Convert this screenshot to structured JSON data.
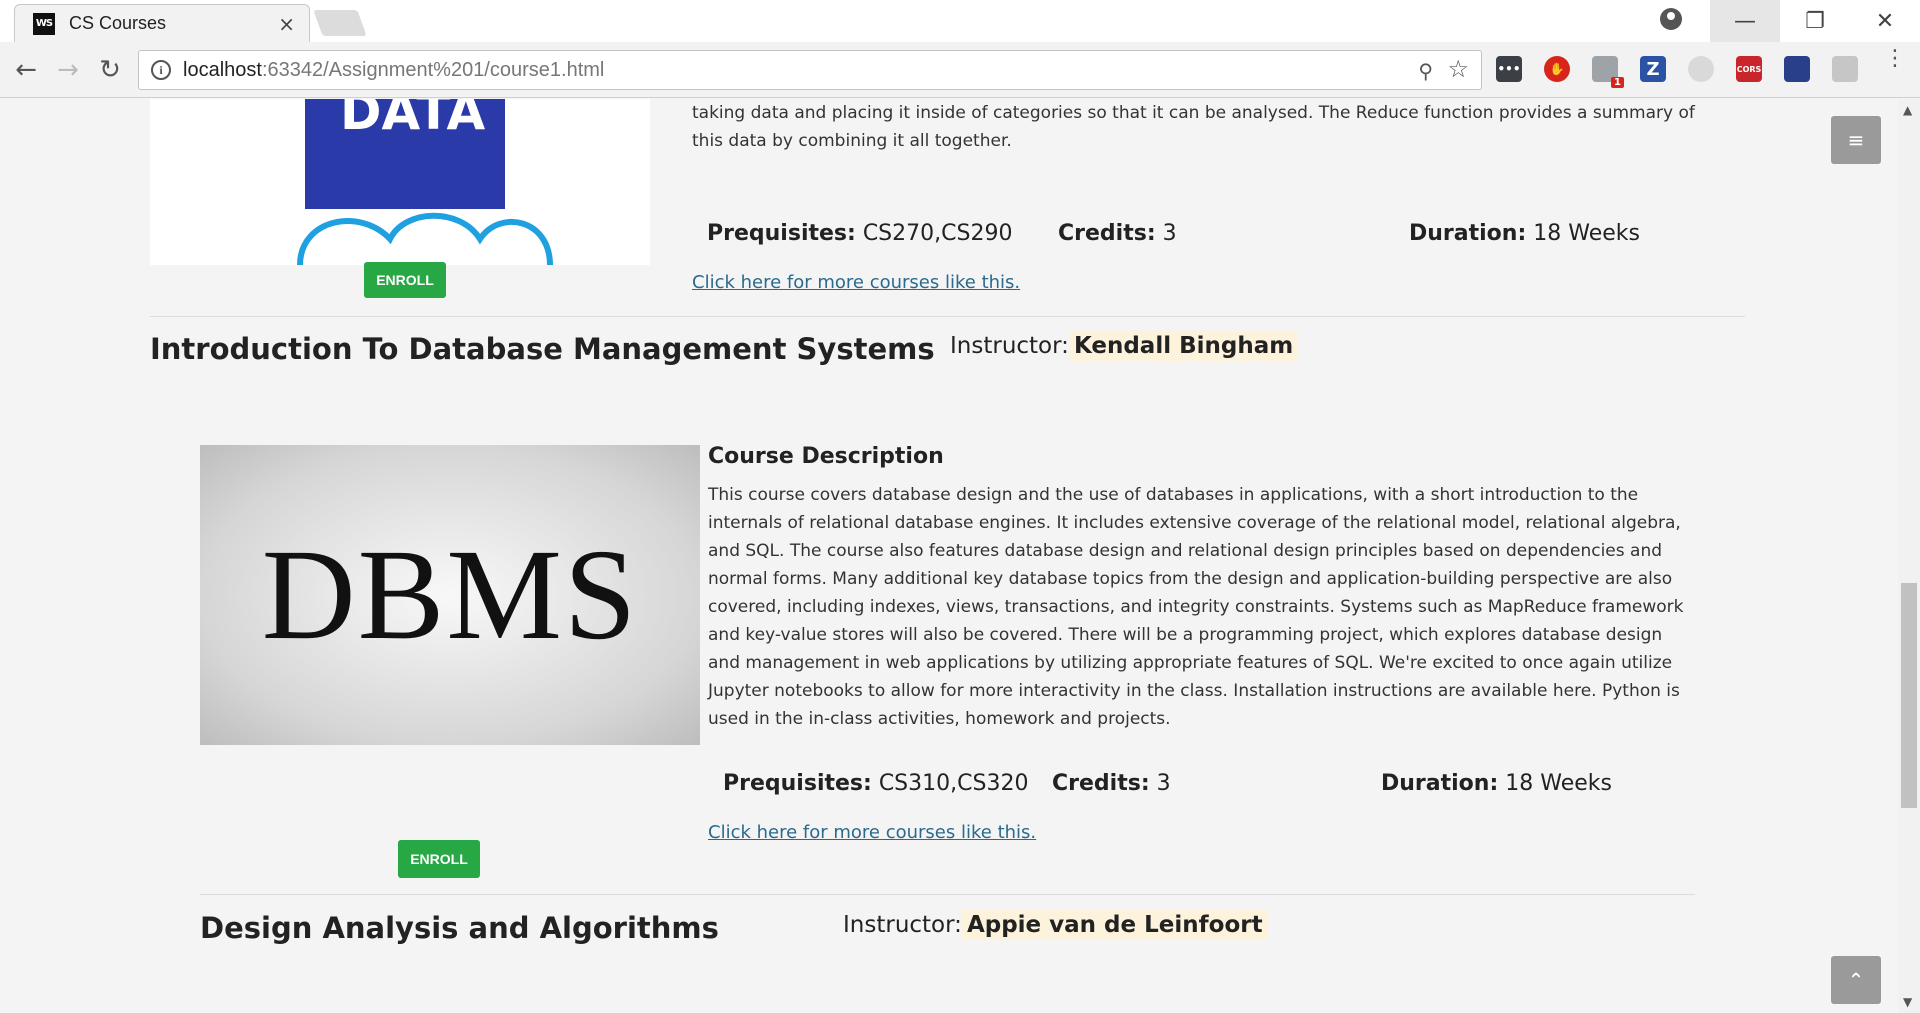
{
  "browser": {
    "tab_title": "CS Courses",
    "tab_favicon": "WS",
    "tab_close": "×",
    "url_host": "localhost",
    "url_rest": ":63342/Assignment%201/course1.html",
    "extensions": {
      "badge_count": "1",
      "zotero_label": "Z",
      "cors_label": "CORS"
    }
  },
  "course1": {
    "description_tail": "taking data and placing it inside of categories so that it can be analysed. The Reduce function provides a summary of this data by combining it all together.",
    "prereq_label": "Prequisites:",
    "prereq_value": "CS270,CS290",
    "credits_label": "Credits:",
    "credits_value": "3",
    "duration_label": "Duration:",
    "duration_value": "18 Weeks",
    "more_link": "Click here for more courses like this.",
    "enroll_label": "ENROLL"
  },
  "course2": {
    "title": "Introduction To Database Management Systems",
    "instructor_label": "Instructor:",
    "instructor_name": "Kendall Bingham",
    "image_text": "DBMS",
    "description_heading": "Course Description",
    "description": "This course covers database design and the use of databases in applications, with a short introduction to the internals of relational database engines. It includes extensive coverage of the relational model, relational algebra, and SQL. The course also features database design and relational design principles based on dependencies and normal forms. Many additional key database topics from the design and application-building perspective are also covered, including indexes, views, transactions, and integrity constraints. Systems such as MapReduce framework and key-value stores will also be covered. There will be a programming project, which explores database design and management in web applications by utilizing appropriate features of SQL. We're excited to once again utilize Jupyter notebooks to allow for more interactivity in the class. Installation instructions are available here. Python is used in the in-class activities, homework and projects.",
    "prereq_label": "Prequisites:",
    "prereq_value": "CS310,CS320",
    "credits_label": "Credits:",
    "credits_value": "3",
    "duration_label": "Duration:",
    "duration_value": "18 Weeks",
    "more_link": "Click here for more courses like this.",
    "enroll_label": "ENROLL"
  },
  "course3": {
    "title": "Design Analysis and Algorithms",
    "instructor_label": "Instructor:",
    "instructor_name": "Appie van de Leinfoort"
  },
  "icons": {
    "menu": "≡",
    "scroll_top": "⌃"
  }
}
